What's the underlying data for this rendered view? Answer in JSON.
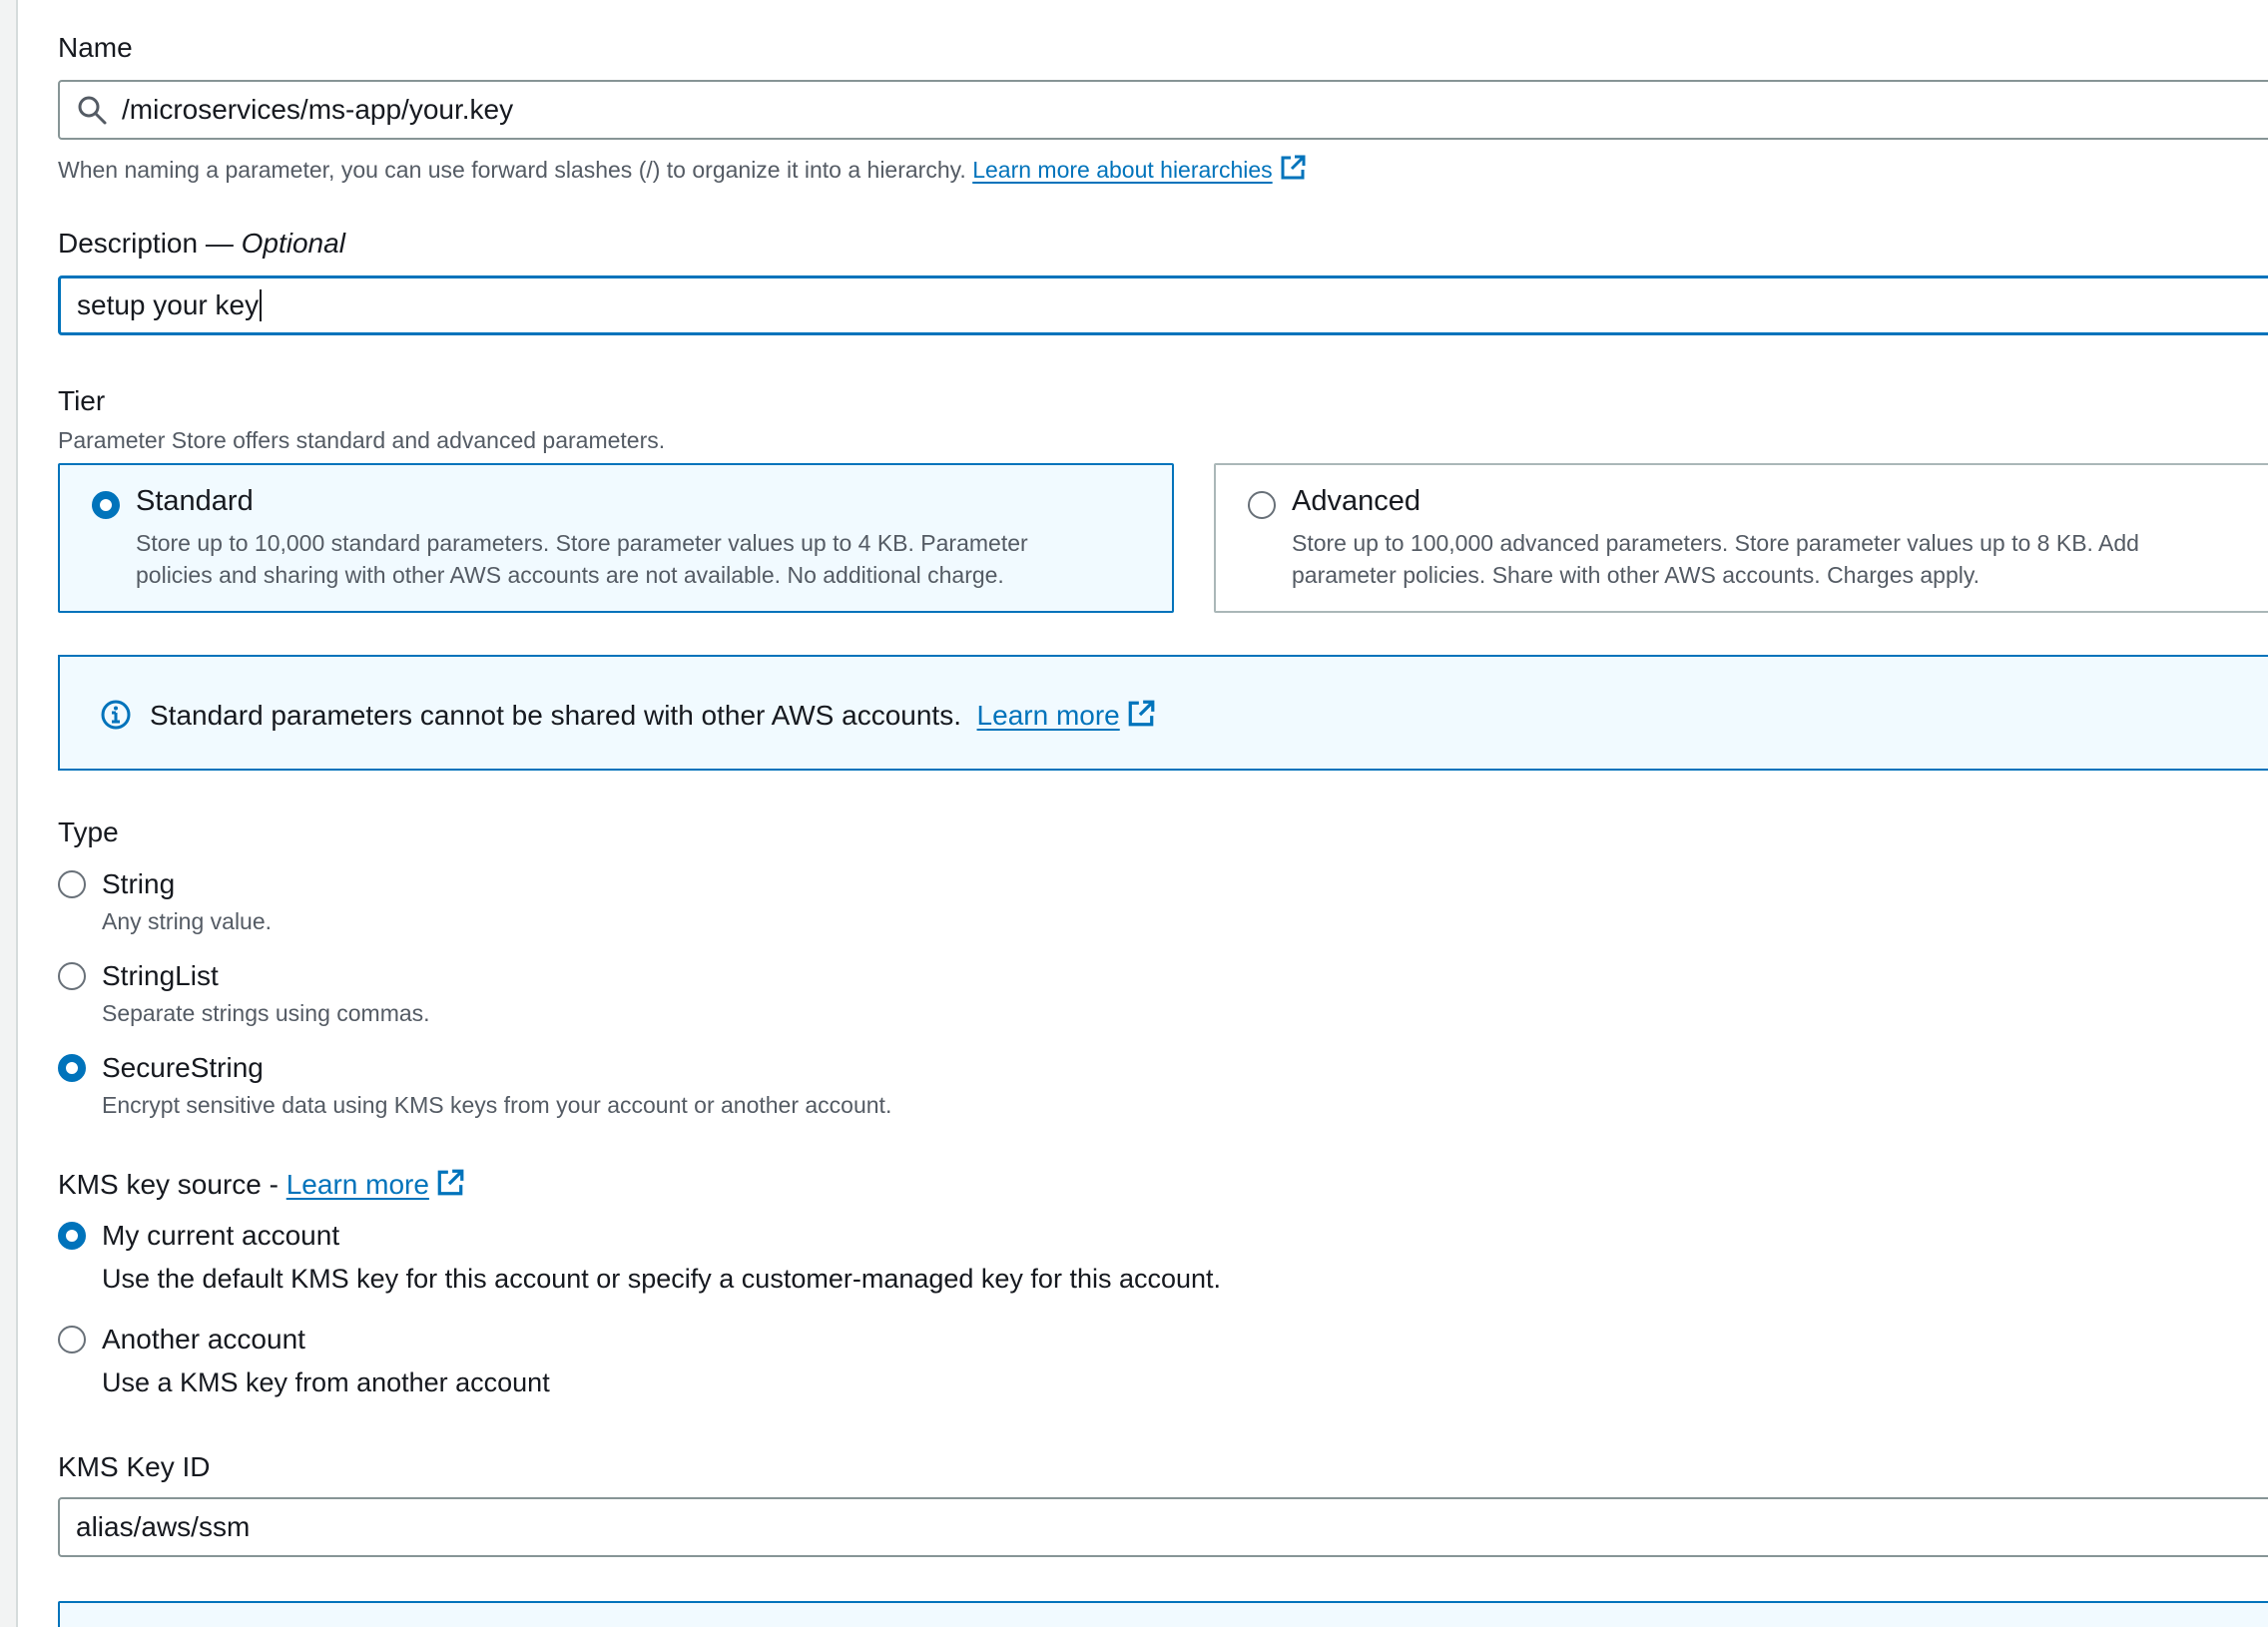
{
  "name_field": {
    "label": "Name",
    "value": "/microservices/ms-app/your.key",
    "hint": "When naming a parameter, you can use forward slashes (/) to organize it into a hierarchy.",
    "hint_link": "Learn more about hierarchies",
    "icon": "search-icon"
  },
  "description_field": {
    "label": "Description —",
    "label_optional": "Optional",
    "value": "setup your key"
  },
  "tier": {
    "label": "Tier",
    "hint": "Parameter Store offers standard and advanced parameters.",
    "options": [
      {
        "title": "Standard",
        "line1": "Store up to 10,000 standard parameters. Store parameter values up to 4 KB. Parameter",
        "line2": "policies and sharing with other AWS accounts are not available. No additional charge.",
        "selected": true
      },
      {
        "title": "Advanced",
        "line1": "Store up to 100,000 advanced parameters. Store parameter values up to 8 KB. Add",
        "line2": "parameter policies. Share with other AWS accounts. Charges apply.",
        "selected": false
      }
    ]
  },
  "info_alert": {
    "text": "Standard parameters cannot be shared with other AWS accounts.",
    "link": "Learn more",
    "icon": "info-icon"
  },
  "type": {
    "label": "Type",
    "options": [
      {
        "title": "String",
        "desc": "Any string value.",
        "selected": false
      },
      {
        "title": "StringList",
        "desc": "Separate strings using commas.",
        "selected": false
      },
      {
        "title": "SecureString",
        "desc": "Encrypt sensitive data using KMS keys from your account or another account.",
        "selected": true
      }
    ]
  },
  "kms_source": {
    "label": "KMS key source -",
    "link": "Learn more",
    "options": [
      {
        "title": "My current account",
        "desc": "Use the default KMS key for this account or specify a customer-managed key for this account.",
        "selected": true
      },
      {
        "title": "Another account",
        "desc": "Use a KMS key from another account",
        "selected": false
      }
    ]
  },
  "kms_key_id": {
    "label": "KMS Key ID",
    "value": "alias/aws/ssm"
  },
  "colors": {
    "accent": "#0073bb",
    "info_bg": "#f1faff",
    "text": "#16191f",
    "muted": "#545b64"
  }
}
